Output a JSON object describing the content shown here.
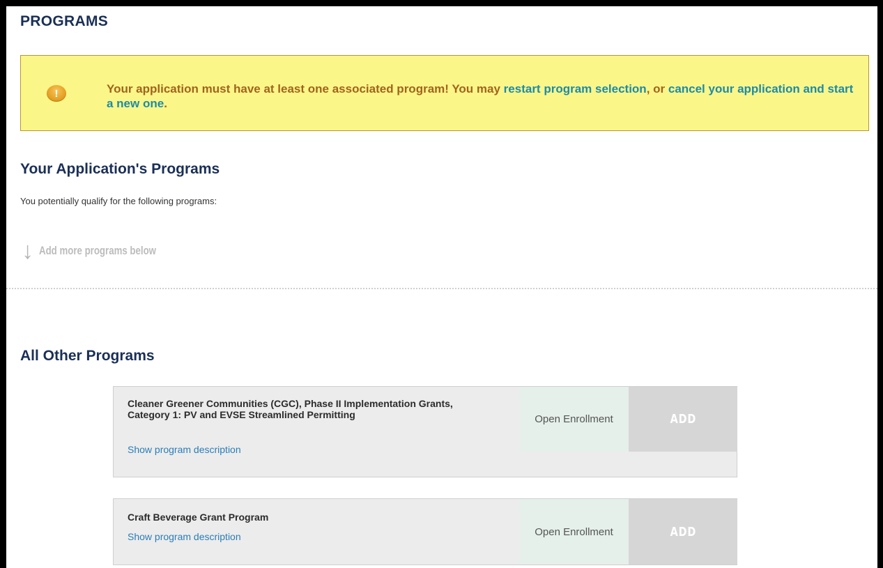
{
  "page": {
    "title": "PROGRAMS"
  },
  "alert": {
    "icon": "exclamation-icon",
    "text_before": "Your application must have at least one associated program! You may ",
    "link1": "restart program selection",
    "text_middle": ", or ",
    "link2": "cancel your application and start a new one",
    "text_after": "."
  },
  "your_programs": {
    "heading": "Your Application's Programs",
    "intro": "You potentially qualify for the following programs:",
    "add_more_icon": "down-arrow-icon",
    "add_more_label": "Add more programs below"
  },
  "other_programs": {
    "heading": "All Other Programs",
    "programs": [
      {
        "name": "Cleaner Greener Communities (CGC), Phase II Implementation Grants, Category 1: PV and EVSE Streamlined Permitting",
        "description_link": "Show program description",
        "status": "Open Enrollment",
        "button": "ADD"
      },
      {
        "name": "Craft Beverage Grant Program",
        "description_link": "Show program description",
        "status": "Open Enrollment",
        "button": "ADD"
      }
    ]
  },
  "colors": {
    "heading": "#1a2f57",
    "alert_bg": "#fbf688",
    "alert_text": "#a0641c",
    "link": "#1c8ba8",
    "status_bg": "#e5f0ea",
    "add_button_bg": "#d6d6d6"
  }
}
